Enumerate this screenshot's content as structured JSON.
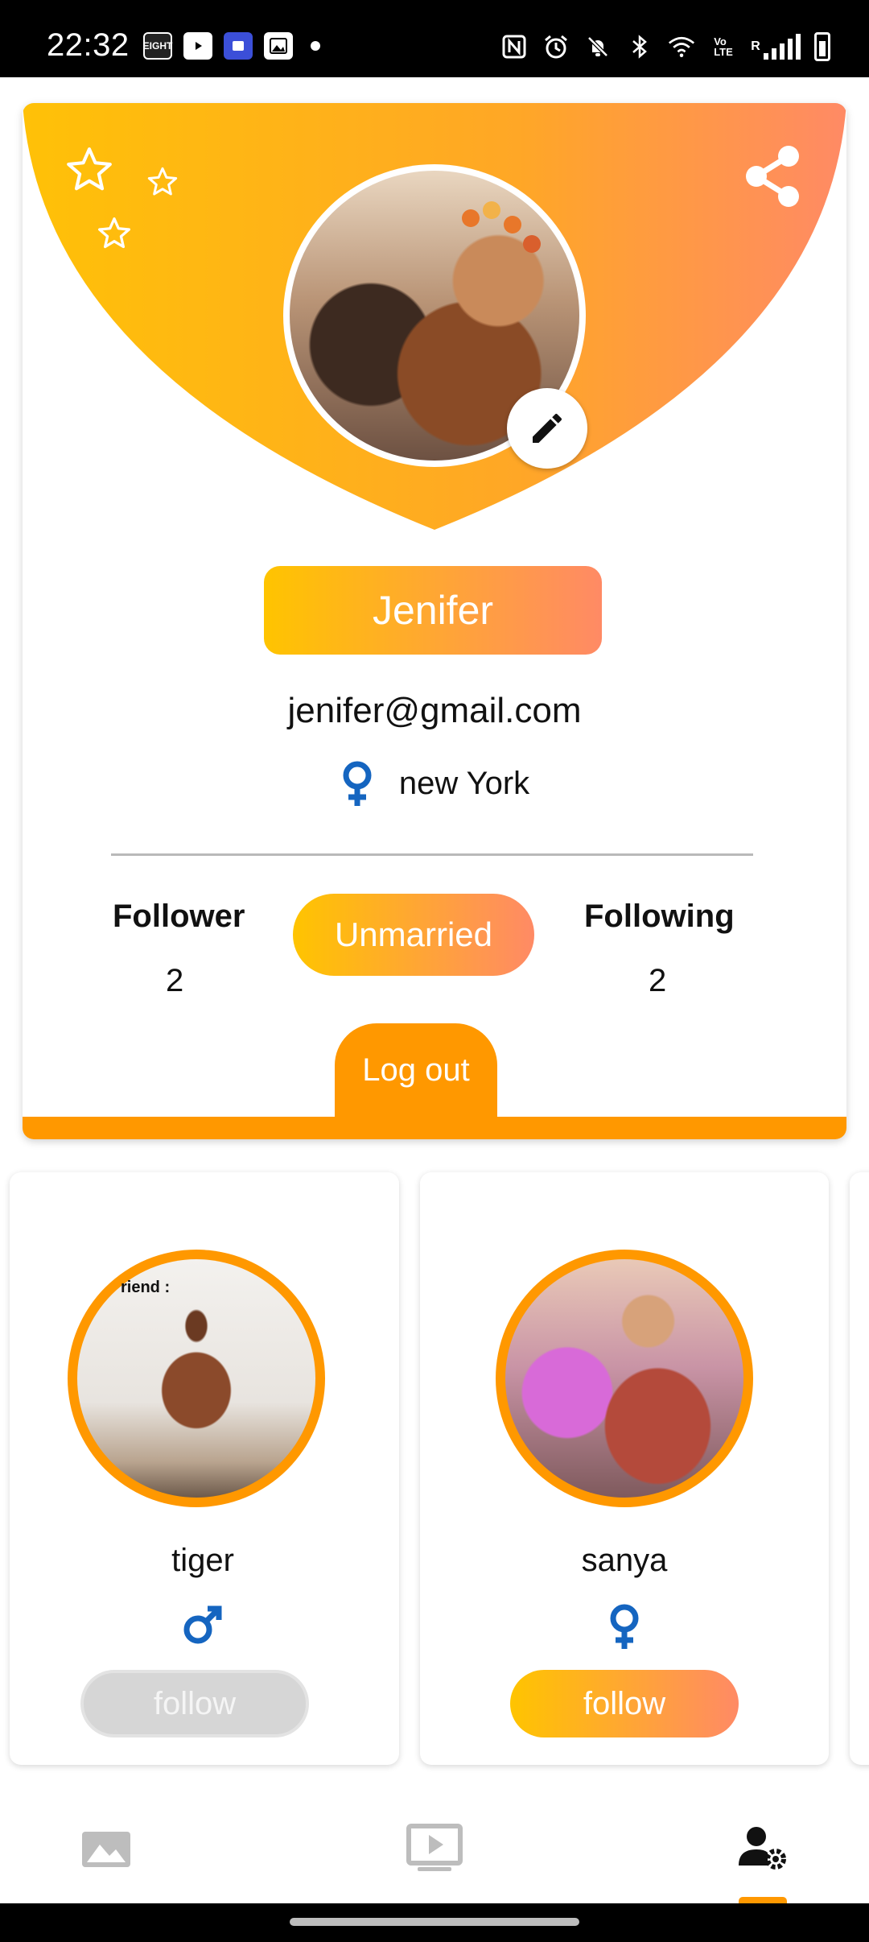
{
  "status_bar": {
    "time": "22:32",
    "left_icons": [
      "eight-app-icon",
      "youtube-icon",
      "store-icon",
      "gallery-icon",
      "dot-icon"
    ],
    "left_icon_labels": [
      "EIGHT"
    ],
    "right_icons": [
      "nfc-icon",
      "alarm-icon",
      "bell-off-icon",
      "bluetooth-icon",
      "wifi-icon",
      "volte-icon",
      "signal-icon",
      "battery-icon"
    ],
    "volte_text": "Vo\nLTE",
    "roaming_text": "R"
  },
  "profile": {
    "name": "Jenifer",
    "email": "jenifer@gmail.com",
    "gender_icon": "female-icon",
    "location": "new York",
    "follower_label": "Follower",
    "follower_count": "2",
    "following_label": "Following",
    "following_count": "2",
    "relationship_status": "Unmarried",
    "logout_label": "Log out"
  },
  "friends": {
    "caption": "riend :",
    "items": [
      {
        "name": "tiger",
        "gender_icon": "male-icon",
        "follow_label": "follow",
        "follow_state": "disabled"
      },
      {
        "name": "sanya",
        "gender_icon": "female-icon",
        "follow_label": "follow",
        "follow_state": "active"
      }
    ]
  },
  "bottom_nav": {
    "items": [
      "photo-gallery-icon",
      "video-player-icon",
      "profile-settings-icon"
    ],
    "active_index": 2
  },
  "colors": {
    "accent_orange": "#ff9800",
    "gradient_start": "#ffc400",
    "gradient_end": "#ff8a65",
    "gender_blue": "#1565c0",
    "disabled_gray": "#d6d6d6"
  }
}
